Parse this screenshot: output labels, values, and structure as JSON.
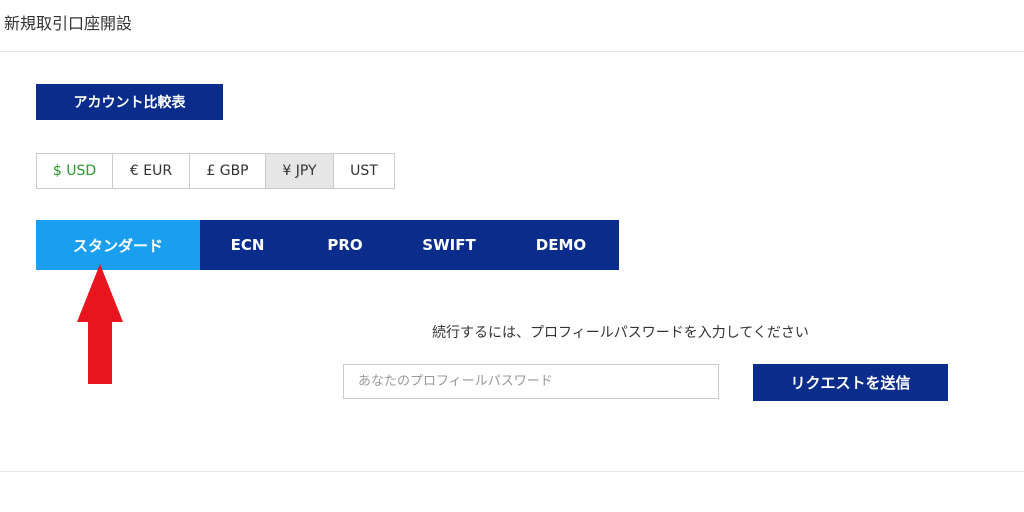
{
  "header": {
    "title": "新規取引口座開設"
  },
  "compare_button": {
    "label": "アカウント比較表"
  },
  "currencies": [
    {
      "label": "$ USD"
    },
    {
      "label": "€ EUR"
    },
    {
      "label": "£ GBP"
    },
    {
      "label": "¥ JPY"
    },
    {
      "label": "UST"
    }
  ],
  "account_tabs": [
    {
      "label": "スタンダード"
    },
    {
      "label": "ECN"
    },
    {
      "label": "PRO"
    },
    {
      "label": "SWIFT"
    },
    {
      "label": "DEMO"
    }
  ],
  "password_form": {
    "prompt": "続行するには、プロフィールパスワードを入力してください",
    "placeholder": "あなたのプロフィールパスワード",
    "value": "",
    "submit_label": "リクエストを送信"
  },
  "colors": {
    "navy": "#0a2d8c",
    "active_tab": "#1a9ff0",
    "usd_text": "#2a9a2a",
    "arrow": "#e8141e"
  },
  "icons": {
    "annotation": "red-up-arrow"
  }
}
